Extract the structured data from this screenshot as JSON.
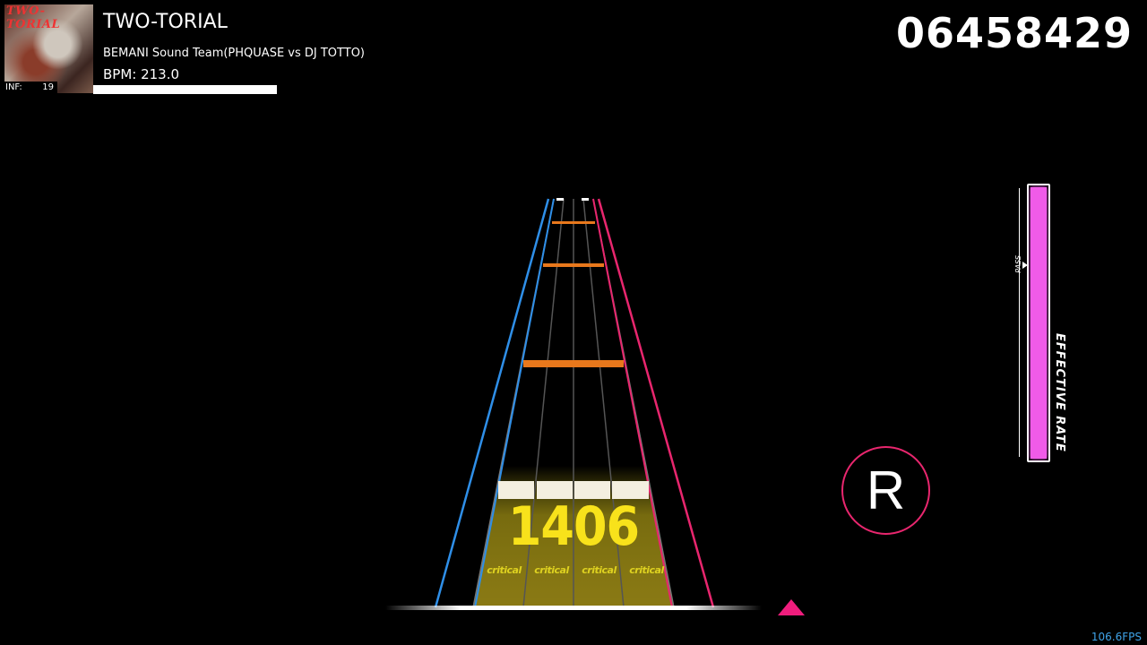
{
  "song": {
    "title": "TWO-TORIAL",
    "artist": "BEMANI Sound Team(PHQUASE vs DJ TOTTO)",
    "bpm_text": "BPM: 213.0",
    "jacket_text": "TWO-TORIAL",
    "difficulty_label": "INF:",
    "level": "19",
    "bpm_progress": 1.0
  },
  "score": "06458429",
  "combo": "1406",
  "judgement": [
    "critical",
    "critical",
    "critical",
    "critical"
  ],
  "laser_right_label": "R",
  "gauge": {
    "label": "EFFECTIVE RATE",
    "pass_label": "PASS",
    "value": 1.0,
    "color": "#f05be8"
  },
  "fps": "106.6FPS",
  "colors": {
    "laser_left": "#2f8fe8",
    "laser_right": "#e8266e",
    "bt_chip": "#f4efe0",
    "fx_note": "#e8781c",
    "combo": "#f8e21b"
  }
}
